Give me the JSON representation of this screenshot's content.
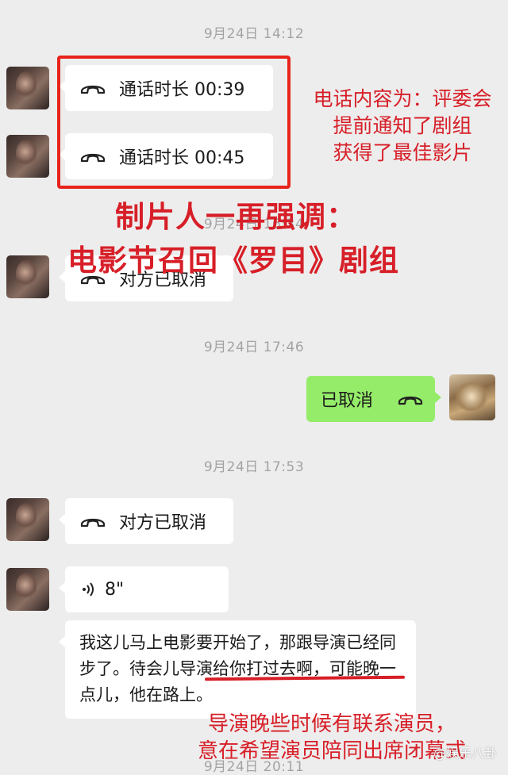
{
  "timestamps": [
    "9月24日 14:12",
    "9月24日 16:34",
    "9月24日 17:46",
    "9月24日 17:53",
    "9月24日 20:11"
  ],
  "messages": {
    "call1": "通话时长 00:39",
    "call2": "通话时长 00:45",
    "cancel1": "对方已取消",
    "me_cancel": "已取消",
    "cancel2": "对方已取消",
    "voice_duration": "8\"",
    "text_message": {
      "part1": "我这儿马上电影要开始了，那跟导演已经同步了。",
      "part2": "待会儿导演给你打过去",
      "part3": "啊，可能晚一点儿，他在路上。"
    }
  },
  "annotations": {
    "call_content": [
      "电话内容为：评委会",
      "提前通知了剧组",
      "获得了最佳影片"
    ],
    "producer_line1": "制片人一再强调：",
    "producer_line2": "电影节召回《罗目》剧组",
    "director_note": [
      "导演晚些时候有联系演员，",
      "意在希望演员陪同出席闭幕式"
    ]
  },
  "watermark": "@娱乐八卦"
}
